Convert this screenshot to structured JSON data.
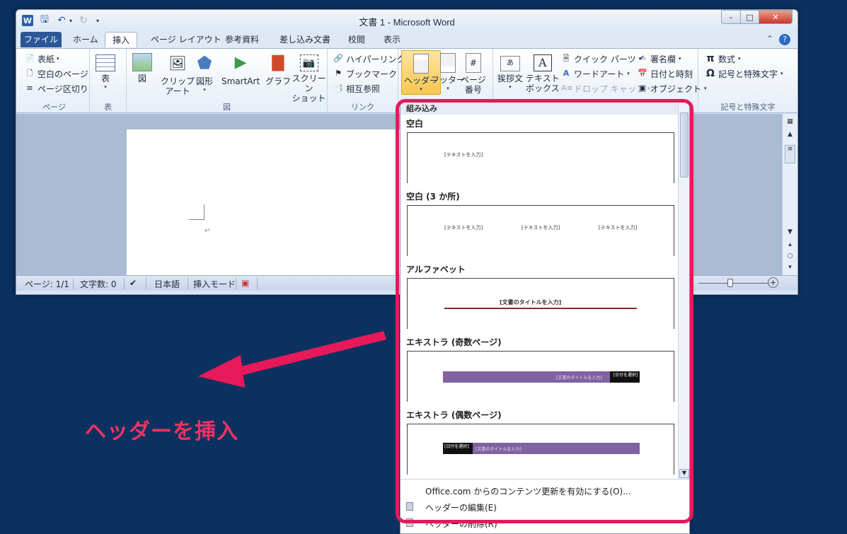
{
  "app": {
    "title": "文書 1 - Microsoft Word",
    "app_icon_letter": "W"
  },
  "tabs": [
    {
      "label": "ファイル"
    },
    {
      "label": "ホーム"
    },
    {
      "label": "挿入"
    },
    {
      "label": "ページ レイアウト"
    },
    {
      "label": "参考資料"
    },
    {
      "label": "差し込み文書"
    },
    {
      "label": "校閲"
    },
    {
      "label": "表示"
    }
  ],
  "ribbon": {
    "pages": {
      "label": "ページ",
      "cover": "表紙",
      "blank": "空白のページ",
      "break": "ページ区切り"
    },
    "tables": {
      "label": "表",
      "table": "表"
    },
    "illustrations": {
      "label": "図",
      "picture": "図",
      "clipart": "クリップ\nアート",
      "clipart_1": "クリップ",
      "clipart_2": "アート",
      "shapes": "図形",
      "smartart": "SmartArt",
      "chart": "グラフ",
      "screenshot_1": "スクリーン",
      "screenshot_2": "ショット"
    },
    "links": {
      "label": "リンク",
      "hyperlink": "ハイパーリンク",
      "bookmark": "ブックマーク",
      "crossref": "相互参照"
    },
    "header_footer": {
      "header": "ヘッダー",
      "footer": "フッター",
      "pagenum_1": "ページ",
      "pagenum_2": "番号"
    },
    "text": {
      "greeting": "挨拶文",
      "textbox_1": "テキスト",
      "textbox_2": "ボックス",
      "quickparts": "クイック パーツ",
      "wordart": "ワードアート",
      "dropcap": "ドロップ キャップ",
      "signature": "署名欄",
      "datetime": "日付と時刻",
      "object": "オブジェクト"
    },
    "symbols": {
      "label": "記号と特殊文字",
      "equation": "数式",
      "symbol": "記号と特殊文字"
    }
  },
  "status": {
    "page": "ページ: 1/1",
    "words": "文字数: 0",
    "language": "日本語",
    "mode": "挿入モード"
  },
  "gallery": {
    "section": "組み込み",
    "items": [
      {
        "title": "空白",
        "placeholder": "[テキストを入力]"
      },
      {
        "title": "空白 (3 か所)",
        "placeholder": "[テキストを入力]"
      },
      {
        "title": "アルファベット",
        "placeholder": "[文書のタイトルを入力]"
      },
      {
        "title": "エキストラ (奇数ページ)",
        "placeholder": "[文書のタイトルを入力]",
        "date": "[日付を選択]"
      },
      {
        "title": "エキストラ (偶数ページ)",
        "placeholder": "[文書のタイトルを入力]",
        "date": "[日付を選択]"
      }
    ],
    "commands": {
      "office_update": "Office.com からのコンテンツ更新を有効にする(O)...",
      "edit_header": "ヘッダーの編集(E)",
      "remove_header": "ヘッダーの削除(R)"
    }
  },
  "annotation": {
    "callout": "ヘッダーを挿入",
    "color": "#e8195b"
  }
}
